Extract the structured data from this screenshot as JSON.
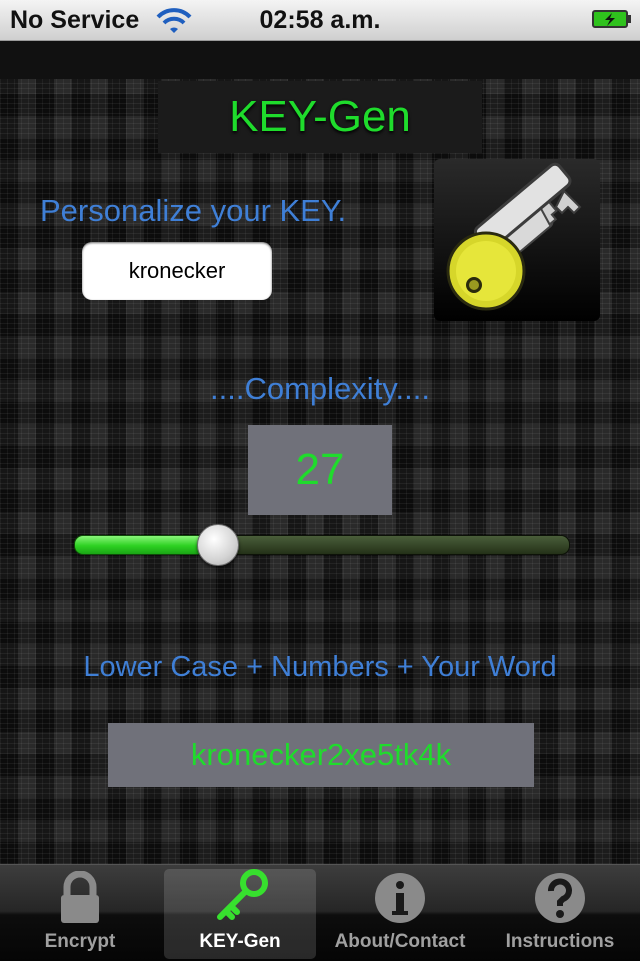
{
  "status_bar": {
    "carrier": "No Service",
    "time": "02:58 a.m.",
    "wifi_icon": "wifi-icon",
    "battery_icon": "battery-charging-icon"
  },
  "app": {
    "title": "KEY-Gen",
    "personalize_label": "Personalize your KEY.",
    "name_input_value": "kronecker",
    "key_image_icon": "key-icon",
    "complexity_label": "....Complexity....",
    "complexity_value": "27",
    "complexity_level": 0.29,
    "mode_label": "Lower Case + Numbers + Your Word",
    "generated_key": "kronecker2xe5tk4k"
  },
  "tabs": [
    {
      "label": "Encrypt",
      "icon": "lock-icon",
      "active": false
    },
    {
      "label": "KEY-Gen",
      "icon": "key-icon",
      "active": true
    },
    {
      "label": "About/Contact",
      "icon": "info-icon",
      "active": false
    },
    {
      "label": "Instructions",
      "icon": "question-icon",
      "active": false
    }
  ],
  "colors": {
    "accent_green": "#1fdc2c",
    "label_blue": "#3f7fd6",
    "value_box_gray": "#70717a"
  }
}
